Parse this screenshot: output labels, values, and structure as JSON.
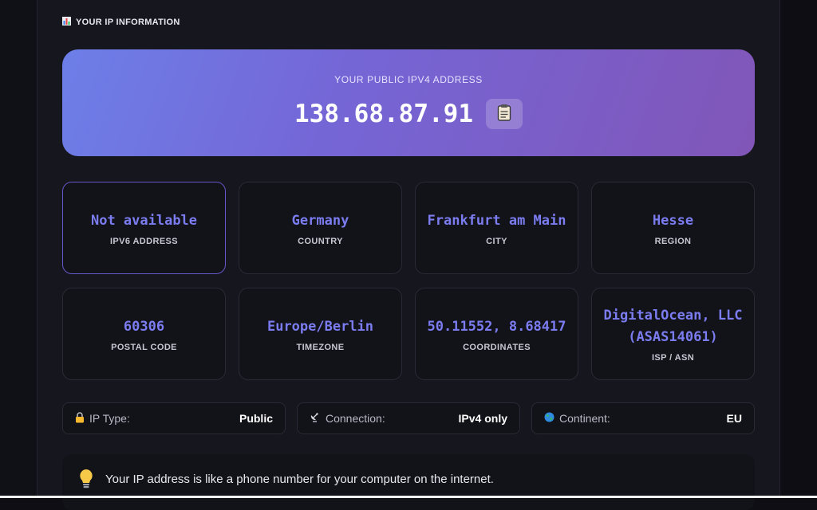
{
  "section": {
    "icon": "bar-chart-icon",
    "title": "YOUR IP INFORMATION"
  },
  "hero": {
    "label": "YOUR PUBLIC IPV4 ADDRESS",
    "ip": "138.68.87.91",
    "copy_icon": "clipboard-icon"
  },
  "cards": [
    {
      "value": "Not available",
      "label": "IPV6 ADDRESS"
    },
    {
      "value": "Germany",
      "label": "COUNTRY"
    },
    {
      "value": "Frankfurt am Main",
      "label": "CITY"
    },
    {
      "value": "Hesse",
      "label": "REGION"
    },
    {
      "value": "60306",
      "label": "POSTAL CODE"
    },
    {
      "value": "Europe/Berlin",
      "label": "TIMEZONE"
    },
    {
      "value": "50.11552, 8.68417",
      "label": "COORDINATES"
    },
    {
      "value": "DigitalOcean, LLC (ASAS14061)",
      "label": "ISP / ASN"
    }
  ],
  "info": [
    {
      "icon": "lock-icon",
      "label": "IP Type:",
      "value": "Public"
    },
    {
      "icon": "satellite-antenna-icon",
      "label": "Connection:",
      "value": "IPv4 only"
    },
    {
      "icon": "globe-icon",
      "label": "Continent:",
      "value": "EU"
    }
  ],
  "tip": {
    "icon": "lightbulb-icon",
    "text": "Your IP address is like a phone number for your computer on the internet."
  }
}
